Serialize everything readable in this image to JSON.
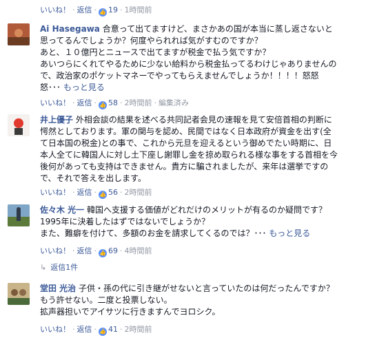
{
  "meta_top": {
    "like": "いいね！",
    "reply": "返信",
    "likes": "19",
    "time": "1時間前"
  },
  "comments": [
    {
      "author": "Ai Hasegawa",
      "lines": [
        "合意って出てますけど、まさかあの国が本当に蒸し返さないと",
        "思ってるんでしょうか？何度やられれば気がすむのですか？",
        "あと、１０億円とニュースで出てますが税金で払う気ですか？",
        "あいつらにくれてやるために少ない給料から税金払ってるわけじゃありませんの",
        "で、政治家のポケットマネーでやってもらえませんでしょうか！！！！怒怒",
        "怒･･･"
      ],
      "more": "もっと見る",
      "meta": {
        "like": "いいね！",
        "reply": "返信",
        "likes": "58",
        "time": "2時間前",
        "edited": "編集済み"
      }
    },
    {
      "author": "井上優子",
      "lines": [
        "外相会談の結果を述べる共同記者会見の速報を見て安倍首相の判断に",
        "愕然としております。軍の関与を認め、民間ではなく日本政府が資金を出す(全",
        "て日本国の税金)との事で、これから元旦を迎えるという御めでたい時期に、日",
        "本人全てに韓国人に対し土下座し謝罪し金を掠め取られる様な事をする首相を今",
        "後何があっても支持はできません。貴方に騙されましたが、来年は選挙ですの",
        "で、それで答えを出します。"
      ],
      "more": "",
      "meta": {
        "like": "いいね！",
        "reply": "返信",
        "likes": "56",
        "time": "2時間前",
        "edited": ""
      }
    },
    {
      "author": "佐々木 光一",
      "lines": [
        "韓国へ支援する価値がどれだけのメリットが有るのか疑問です？",
        "1995年に決着したはずではないでしょうか？",
        "また、難癖を付けて、多額のお金を請求してくるのでは？･･･"
      ],
      "more": "もっと見る",
      "meta": {
        "like": "いいね！",
        "reply": "返信",
        "likes": "69",
        "time": "4時間前",
        "edited": ""
      },
      "replies_label": "返信1件"
    },
    {
      "author": "堂田 光治",
      "lines": [
        "子供・孫の代に引き継がせないと言っていたのは何だったんですか？",
        "もう許せない。二度と投票しない。",
        "拡声器担いでアイサツに行きますんでヨロシク。"
      ],
      "more": "",
      "meta": {
        "like": "いいね！",
        "reply": "返信",
        "likes": "41",
        "time": "2時間前",
        "edited": ""
      }
    }
  ],
  "icons": {
    "like_badge": "thumbs-up-icon",
    "reply_arrow": "reply-arrow-icon"
  },
  "colors": {
    "link": "#3b5998",
    "meta": "#9197a3",
    "like_badge": "#5890ff",
    "text": "#141823"
  }
}
